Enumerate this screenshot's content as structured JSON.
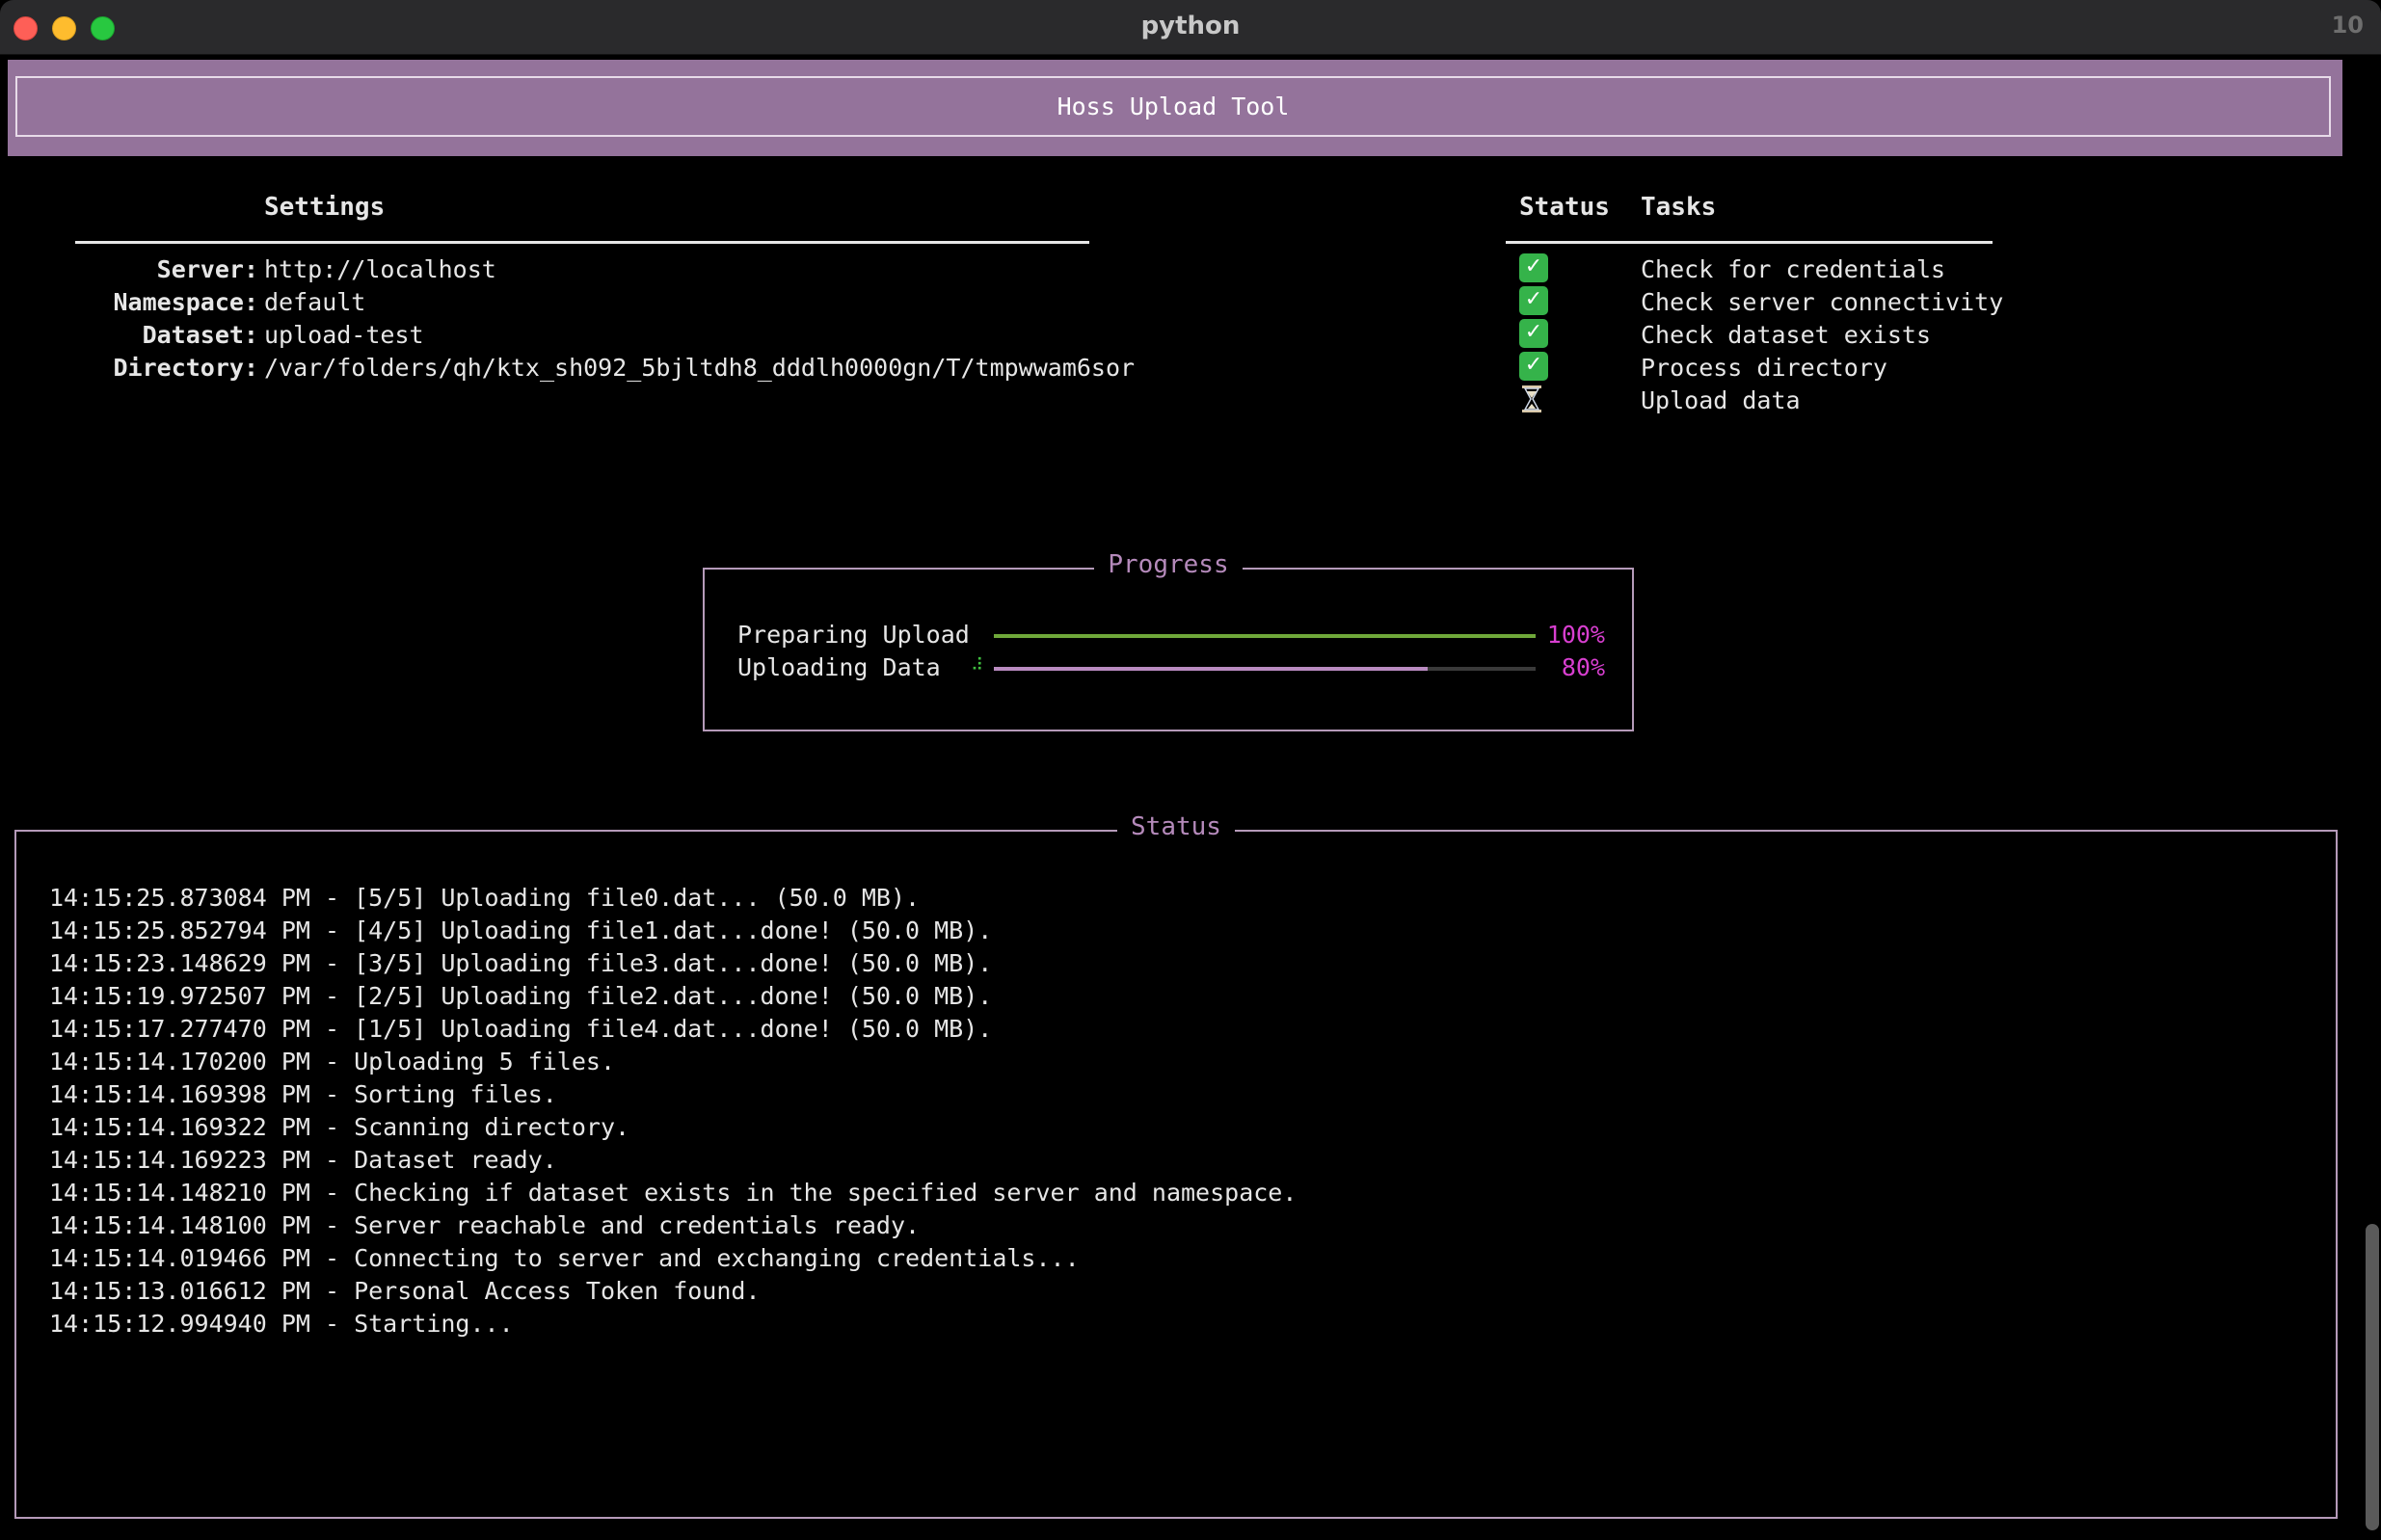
{
  "window": {
    "title": "python",
    "badge": "10"
  },
  "header": {
    "title": "Hoss Upload Tool"
  },
  "settings": {
    "heading": "Settings",
    "rows": [
      {
        "key": "Server:",
        "value": "http://localhost"
      },
      {
        "key": "Namespace:",
        "value": "default"
      },
      {
        "key": "Dataset:",
        "value": "upload-test"
      },
      {
        "key": "Directory:",
        "value": "/var/folders/qh/ktx_sh092_5bjltdh8_dddlh0000gn/T/tmpwwam6sor"
      }
    ]
  },
  "tasks": {
    "status_heading": "Status",
    "tasks_heading": "Tasks",
    "rows": [
      {
        "status": "done",
        "icon": "check-mark-icon",
        "label": "Check for credentials"
      },
      {
        "status": "done",
        "icon": "check-mark-icon",
        "label": "Check server connectivity"
      },
      {
        "status": "done",
        "icon": "check-mark-icon",
        "label": "Check dataset exists"
      },
      {
        "status": "done",
        "icon": "check-mark-icon",
        "label": "Process directory"
      },
      {
        "status": "pending",
        "icon": "hourglass-icon",
        "label": "Upload data"
      }
    ]
  },
  "progress": {
    "title": "Progress",
    "bars": [
      {
        "label": "Preparing Upload",
        "percent_text": "100%",
        "fraction": 1.0,
        "color": "#6fa83a",
        "spinner": ""
      },
      {
        "label": "Uploading Data",
        "percent_text": "80%",
        "fraction": 0.8,
        "color": "#b98bc0",
        "spinner": "⠼"
      }
    ]
  },
  "status": {
    "title": "Status",
    "lines": [
      "14:15:25.873084 PM - [5/5] Uploading file0.dat... (50.0 MB).",
      "14:15:25.852794 PM - [4/5] Uploading file1.dat...done! (50.0 MB).",
      "14:15:23.148629 PM - [3/5] Uploading file3.dat...done! (50.0 MB).",
      "14:15:19.972507 PM - [2/5] Uploading file2.dat...done! (50.0 MB).",
      "14:15:17.277470 PM - [1/5] Uploading file4.dat...done! (50.0 MB).",
      "14:15:14.170200 PM - Uploading 5 files.",
      "14:15:14.169398 PM - Sorting files.",
      "14:15:14.169322 PM - Scanning directory.",
      "14:15:14.169223 PM - Dataset ready.",
      "14:15:14.148210 PM - Checking if dataset exists in the specified server and namespace.",
      "14:15:14.148100 PM - Server reachable and credentials ready.",
      "14:15:14.019466 PM - Connecting to server and exchanging credentials...",
      "14:15:13.016612 PM - Personal Access Token found.",
      "14:15:12.994940 PM - Starting..."
    ]
  },
  "colors": {
    "banner": "#94739b",
    "accent": "#b58abb",
    "percent": "#d83fd0",
    "check": "#35b34a"
  }
}
